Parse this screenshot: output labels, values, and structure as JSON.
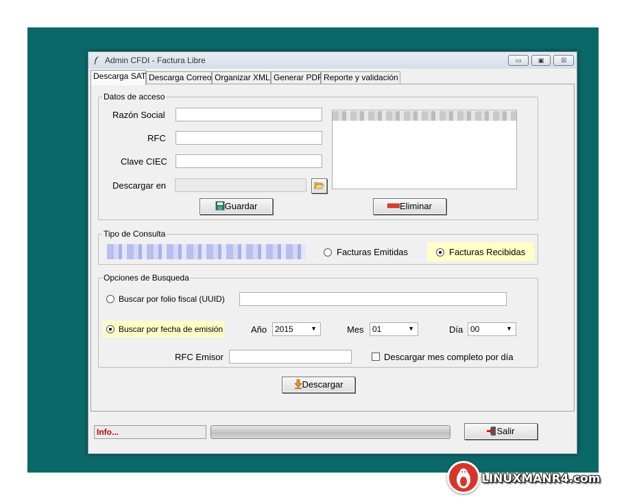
{
  "window": {
    "title": "Admin CFDI - Factura Libre",
    "controls": {
      "minimize": "▭",
      "maximize": "▣",
      "close": "☒"
    }
  },
  "tabs": [
    {
      "label": "Descarga SAT",
      "active": true
    },
    {
      "label": "Descarga Correo"
    },
    {
      "label": "Organizar XML"
    },
    {
      "label": "Generar PDF"
    },
    {
      "label": "Reporte y validación"
    }
  ],
  "datos_acceso": {
    "group_title": "Datos de acceso",
    "razon_social_label": "Razón Social",
    "razon_social_value": "",
    "rfc_label": "RFC",
    "rfc_value": "",
    "clave_ciec_label": "Clave CIEC",
    "clave_ciec_value": "",
    "descargar_en_label": "Descargar en",
    "descargar_en_value": "",
    "folder_icon": "folder-open-icon",
    "guardar_label": "Guardar",
    "eliminar_label": "Eliminar"
  },
  "tipo_consulta": {
    "group_title": "Tipo de Consulta",
    "emitidas_label": "Facturas Emitidas",
    "recibidas_label": "Facturas Recibidas",
    "selected": "recibidas"
  },
  "opciones_busqueda": {
    "group_title": "Opciones de Busqueda",
    "folio_label": "Buscar por folio fiscal (UUID)",
    "folio_value": "",
    "fecha_label": "Buscar por fecha de emisión",
    "selected": "fecha",
    "anio_label": "Año",
    "anio_value": "2015",
    "mes_label": "Mes",
    "mes_value": "01",
    "dia_label": "Día",
    "dia_value": "00",
    "rfc_emisor_label": "RFC Emisor",
    "rfc_emisor_value": "",
    "mes_completo_label": "Descargar mes completo por día",
    "mes_completo_checked": false
  },
  "descargar_label": "Descargar",
  "status": {
    "info_text": "Info...",
    "salir_label": "Salir"
  },
  "watermark": {
    "text": "LINUXMANR4.com"
  },
  "colors": {
    "desktop": "#0b6868",
    "highlight": "#ffffc8",
    "info_text": "#c00000",
    "watermark_badge": "#d9342b"
  }
}
